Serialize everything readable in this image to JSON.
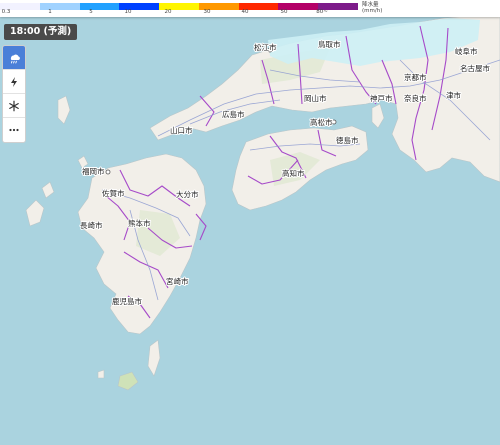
{
  "legend": {
    "unit_label": "降水量\n(mm/h)",
    "ticks": [
      "0.3",
      "1",
      "5",
      "10",
      "20",
      "30",
      "40",
      "50",
      "80~"
    ],
    "colors": [
      "#f2f2ff",
      "#a0d2ff",
      "#21a1ff",
      "#0041ff",
      "#fff500",
      "#ff9900",
      "#ff2800",
      "#b40068",
      "#7d1b8a"
    ]
  },
  "time_badge": "18:00 (予測)",
  "layers": [
    {
      "icon": "rain-icon",
      "active": true
    },
    {
      "icon": "lightning-icon",
      "active": false
    },
    {
      "icon": "snow-icon",
      "active": false
    },
    {
      "icon": "more-icon",
      "active": false
    }
  ],
  "cities": [
    {
      "name": "松江市"
    },
    {
      "name": "鳥取市"
    },
    {
      "name": "京都市"
    },
    {
      "name": "岐阜市"
    },
    {
      "name": "名古屋市"
    },
    {
      "name": "広島市"
    },
    {
      "name": "岡山市"
    },
    {
      "name": "神戸市"
    },
    {
      "name": "奈良市"
    },
    {
      "name": "津市"
    },
    {
      "name": "山口市"
    },
    {
      "name": "高松市"
    },
    {
      "name": "徳島市"
    },
    {
      "name": "福岡市"
    },
    {
      "name": "佐賀市"
    },
    {
      "name": "大分市"
    },
    {
      "name": "高知市"
    },
    {
      "name": "長崎市"
    },
    {
      "name": "熊本市"
    },
    {
      "name": "宮崎市"
    },
    {
      "name": "鹿児島市"
    }
  ],
  "colors": {
    "sea": "#aad3df",
    "land": "#f2efe9",
    "forest": "#d8e6c8",
    "boundary": "#a64ac9",
    "road": "#8c9ad1",
    "precip": "#cdeff5"
  }
}
